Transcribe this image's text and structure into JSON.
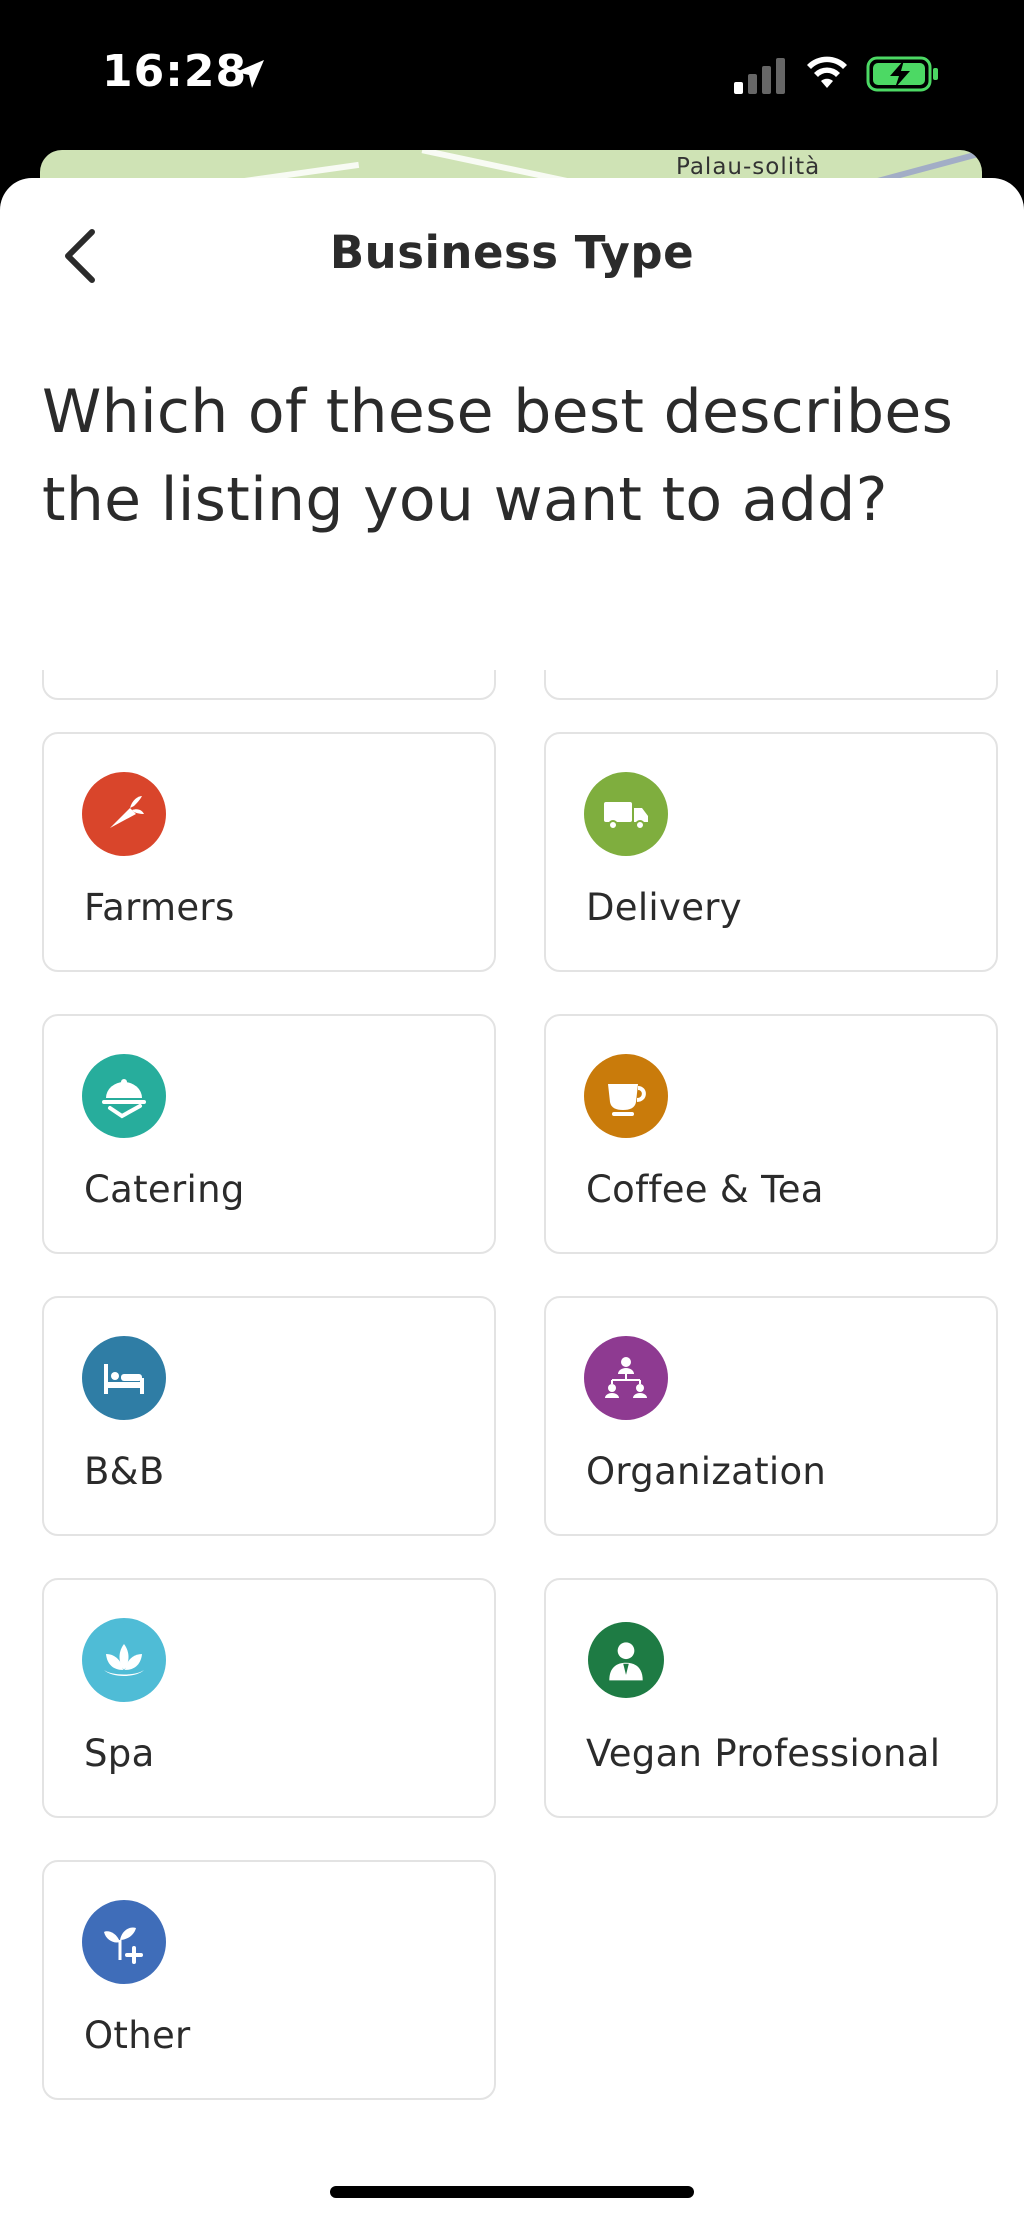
{
  "status_bar": {
    "time": "16:28"
  },
  "map": {
    "label": "Palau-solità"
  },
  "header": {
    "title": "Business Type"
  },
  "question": "Which of these best describes the listing you want to add?",
  "options": [
    {
      "label": "Farmers",
      "color": "#d9452b",
      "icon": "carrot-icon"
    },
    {
      "label": "Delivery",
      "color": "#7fae3e",
      "icon": "truck-icon"
    },
    {
      "label": "Catering",
      "color": "#27ad9c",
      "icon": "serving-dish-icon"
    },
    {
      "label": "Coffee & Tea",
      "color": "#c97b0b",
      "icon": "coffee-cup-icon"
    },
    {
      "label": "B&B",
      "color": "#2f7da5",
      "icon": "bed-icon"
    },
    {
      "label": "Organization",
      "color": "#8e3a91",
      "icon": "people-hierarchy-icon"
    },
    {
      "label": "Spa",
      "color": "#4fbcd6",
      "icon": "lotus-icon"
    },
    {
      "label": "Vegan Professional",
      "color": "#1e7b44",
      "icon": "professional-person-icon"
    },
    {
      "label": "Other",
      "color": "#3f6db9",
      "icon": "sprout-plus-icon"
    }
  ]
}
